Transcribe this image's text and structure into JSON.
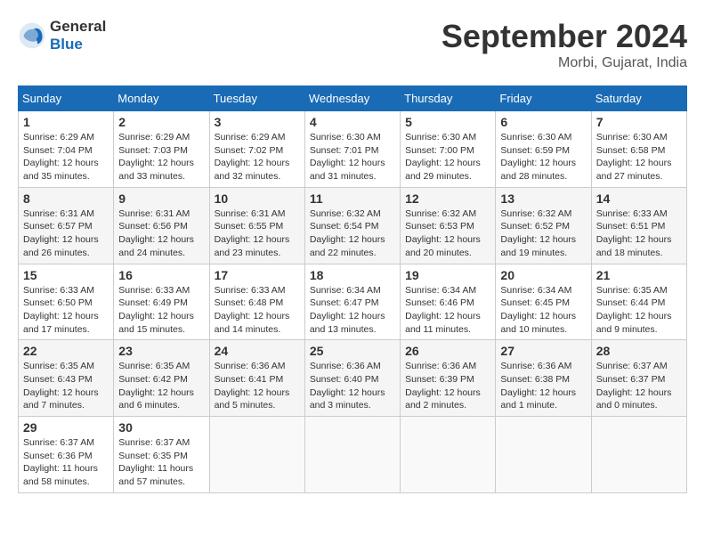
{
  "header": {
    "logo_line1": "General",
    "logo_line2": "Blue",
    "month_title": "September 2024",
    "location": "Morbi, Gujarat, India"
  },
  "weekdays": [
    "Sunday",
    "Monday",
    "Tuesday",
    "Wednesday",
    "Thursday",
    "Friday",
    "Saturday"
  ],
  "weeks": [
    [
      {
        "day": "1",
        "sunrise": "6:29 AM",
        "sunset": "7:04 PM",
        "daylight": "12 hours and 35 minutes."
      },
      {
        "day": "2",
        "sunrise": "6:29 AM",
        "sunset": "7:03 PM",
        "daylight": "12 hours and 33 minutes."
      },
      {
        "day": "3",
        "sunrise": "6:29 AM",
        "sunset": "7:02 PM",
        "daylight": "12 hours and 32 minutes."
      },
      {
        "day": "4",
        "sunrise": "6:30 AM",
        "sunset": "7:01 PM",
        "daylight": "12 hours and 31 minutes."
      },
      {
        "day": "5",
        "sunrise": "6:30 AM",
        "sunset": "7:00 PM",
        "daylight": "12 hours and 29 minutes."
      },
      {
        "day": "6",
        "sunrise": "6:30 AM",
        "sunset": "6:59 PM",
        "daylight": "12 hours and 28 minutes."
      },
      {
        "day": "7",
        "sunrise": "6:30 AM",
        "sunset": "6:58 PM",
        "daylight": "12 hours and 27 minutes."
      }
    ],
    [
      {
        "day": "8",
        "sunrise": "6:31 AM",
        "sunset": "6:57 PM",
        "daylight": "12 hours and 26 minutes."
      },
      {
        "day": "9",
        "sunrise": "6:31 AM",
        "sunset": "6:56 PM",
        "daylight": "12 hours and 24 minutes."
      },
      {
        "day": "10",
        "sunrise": "6:31 AM",
        "sunset": "6:55 PM",
        "daylight": "12 hours and 23 minutes."
      },
      {
        "day": "11",
        "sunrise": "6:32 AM",
        "sunset": "6:54 PM",
        "daylight": "12 hours and 22 minutes."
      },
      {
        "day": "12",
        "sunrise": "6:32 AM",
        "sunset": "6:53 PM",
        "daylight": "12 hours and 20 minutes."
      },
      {
        "day": "13",
        "sunrise": "6:32 AM",
        "sunset": "6:52 PM",
        "daylight": "12 hours and 19 minutes."
      },
      {
        "day": "14",
        "sunrise": "6:33 AM",
        "sunset": "6:51 PM",
        "daylight": "12 hours and 18 minutes."
      }
    ],
    [
      {
        "day": "15",
        "sunrise": "6:33 AM",
        "sunset": "6:50 PM",
        "daylight": "12 hours and 17 minutes."
      },
      {
        "day": "16",
        "sunrise": "6:33 AM",
        "sunset": "6:49 PM",
        "daylight": "12 hours and 15 minutes."
      },
      {
        "day": "17",
        "sunrise": "6:33 AM",
        "sunset": "6:48 PM",
        "daylight": "12 hours and 14 minutes."
      },
      {
        "day": "18",
        "sunrise": "6:34 AM",
        "sunset": "6:47 PM",
        "daylight": "12 hours and 13 minutes."
      },
      {
        "day": "19",
        "sunrise": "6:34 AM",
        "sunset": "6:46 PM",
        "daylight": "12 hours and 11 minutes."
      },
      {
        "day": "20",
        "sunrise": "6:34 AM",
        "sunset": "6:45 PM",
        "daylight": "12 hours and 10 minutes."
      },
      {
        "day": "21",
        "sunrise": "6:35 AM",
        "sunset": "6:44 PM",
        "daylight": "12 hours and 9 minutes."
      }
    ],
    [
      {
        "day": "22",
        "sunrise": "6:35 AM",
        "sunset": "6:43 PM",
        "daylight": "12 hours and 7 minutes."
      },
      {
        "day": "23",
        "sunrise": "6:35 AM",
        "sunset": "6:42 PM",
        "daylight": "12 hours and 6 minutes."
      },
      {
        "day": "24",
        "sunrise": "6:36 AM",
        "sunset": "6:41 PM",
        "daylight": "12 hours and 5 minutes."
      },
      {
        "day": "25",
        "sunrise": "6:36 AM",
        "sunset": "6:40 PM",
        "daylight": "12 hours and 3 minutes."
      },
      {
        "day": "26",
        "sunrise": "6:36 AM",
        "sunset": "6:39 PM",
        "daylight": "12 hours and 2 minutes."
      },
      {
        "day": "27",
        "sunrise": "6:36 AM",
        "sunset": "6:38 PM",
        "daylight": "12 hours and 1 minute."
      },
      {
        "day": "28",
        "sunrise": "6:37 AM",
        "sunset": "6:37 PM",
        "daylight": "12 hours and 0 minutes."
      }
    ],
    [
      {
        "day": "29",
        "sunrise": "6:37 AM",
        "sunset": "6:36 PM",
        "daylight": "11 hours and 58 minutes."
      },
      {
        "day": "30",
        "sunrise": "6:37 AM",
        "sunset": "6:35 PM",
        "daylight": "11 hours and 57 minutes."
      },
      null,
      null,
      null,
      null,
      null
    ]
  ]
}
